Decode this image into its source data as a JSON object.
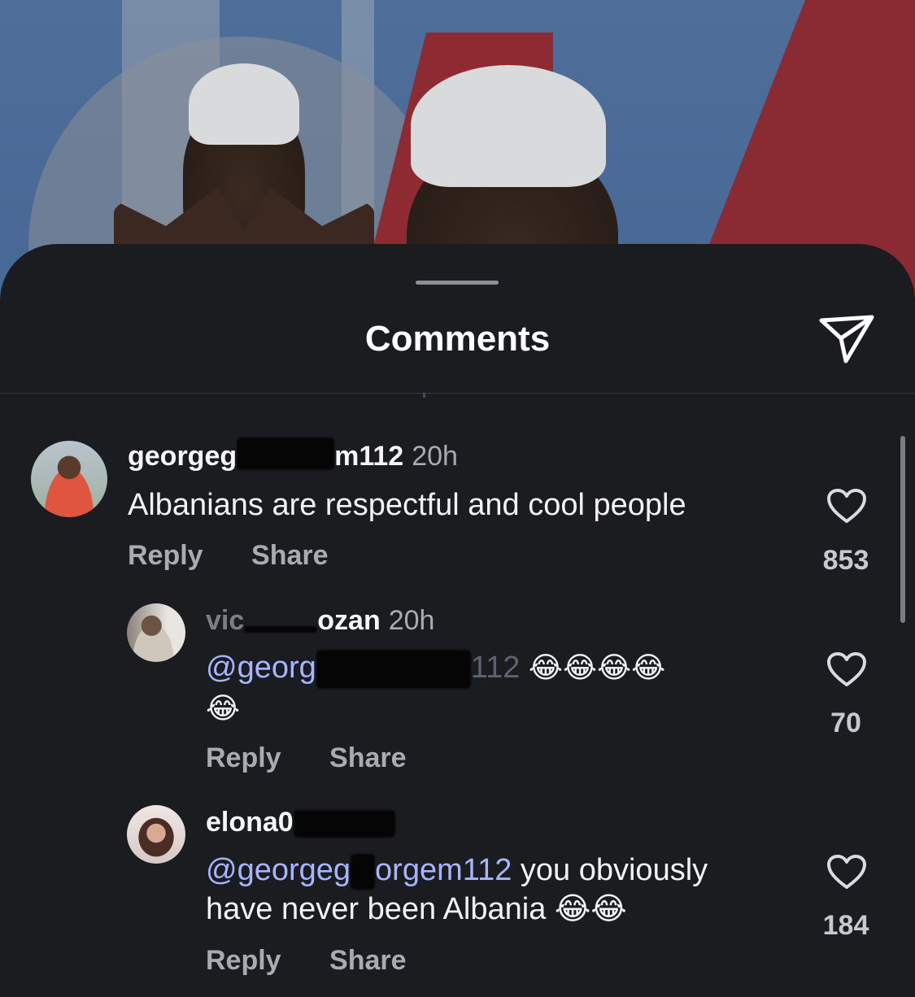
{
  "sheet": {
    "title": "Comments",
    "send_icon": "send-paper-plane-icon"
  },
  "comments": [
    {
      "username_visible_start": "georgeg",
      "username_visible_end": "m112",
      "time": "20h",
      "mention": "",
      "text": "Albanians are respectful and cool people",
      "reply_label": "Reply",
      "share_label": "Share",
      "likes": "853",
      "heart_icon": "heart-outline-icon"
    },
    {
      "username_visible_start": "vic",
      "username_visible_end": "ozan",
      "time": "20h",
      "mention": "@georg",
      "mention_end": "112",
      "text": "😂😂😂😂",
      "text_line2": "😂",
      "reply_label": "Reply",
      "share_label": "Share",
      "likes": "70",
      "heart_icon": "heart-outline-icon"
    },
    {
      "username_visible_start": "elona0",
      "username_visible_end": "",
      "time": "",
      "mention": "@georgeg",
      "mention_end": "orgem112",
      "text": " you obviously",
      "text_line2": "have never been Albania 😂😂",
      "reply_label": "Reply",
      "share_label": "Share",
      "likes": "184",
      "heart_icon": "heart-outline-icon"
    }
  ]
}
